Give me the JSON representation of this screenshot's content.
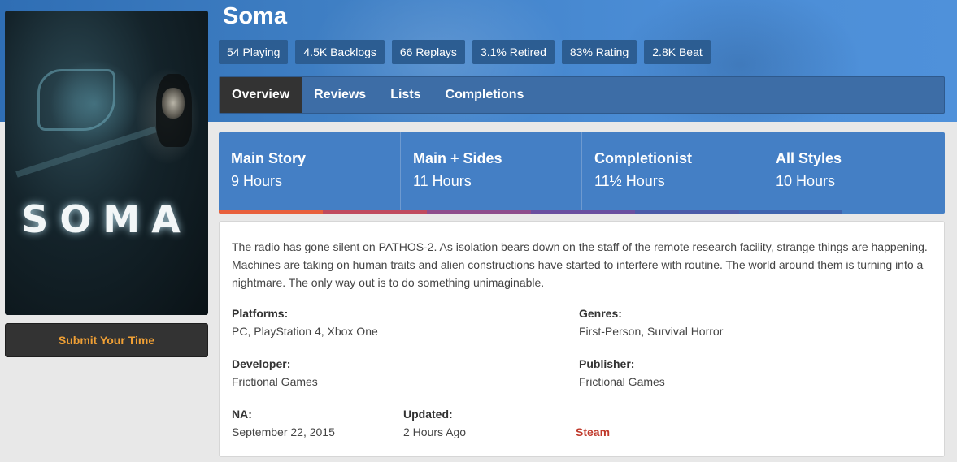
{
  "game": {
    "title": "Soma",
    "cover_logo": "SOMA"
  },
  "stats": [
    {
      "label": "54 Playing"
    },
    {
      "label": "4.5K Backlogs"
    },
    {
      "label": "66 Replays"
    },
    {
      "label": "3.1% Retired"
    },
    {
      "label": "83% Rating"
    },
    {
      "label": "2.8K Beat"
    }
  ],
  "tabs": [
    {
      "label": "Overview",
      "active": true
    },
    {
      "label": "Reviews",
      "active": false
    },
    {
      "label": "Lists",
      "active": false
    },
    {
      "label": "Completions",
      "active": false
    }
  ],
  "times": [
    {
      "label": "Main Story",
      "value": "9 Hours"
    },
    {
      "label": "Main + Sides",
      "value": "11 Hours"
    },
    {
      "label": "Completionist",
      "value": "11½ Hours"
    },
    {
      "label": "All Styles",
      "value": "10 Hours"
    }
  ],
  "time_bar_colors": [
    "#e8603c",
    "#c04a5e",
    "#8e4d8c",
    "#6a4fa0",
    "#4a5aa8",
    "#3f64ae"
  ],
  "submit_label": "Submit Your Time",
  "description": "The radio has gone silent on PATHOS-2. As isolation bears down on the staff of the remote research facility, strange things are happening. Machines are taking on human traits and alien constructions have started to interfere with routine. The world around them is turning into a nightmare. The only way out is to do something unimaginable.",
  "details": {
    "platforms_label": "Platforms:",
    "platforms_value": "PC, PlayStation 4, Xbox One",
    "genres_label": "Genres:",
    "genres_value": "First-Person, Survival Horror",
    "developer_label": "Developer:",
    "developer_value": "Frictional Games",
    "publisher_label": "Publisher:",
    "publisher_value": "Frictional Games",
    "na_label": "NA:",
    "na_value": "September 22, 2015",
    "updated_label": "Updated:",
    "updated_value": "2 Hours Ago",
    "store_link": "Steam"
  },
  "colors": {
    "banner": "#4b8dd6",
    "time_box": "#447fc5",
    "active_tab": "#333333",
    "submit_text": "#f0a035",
    "store_link": "#c0392b"
  }
}
